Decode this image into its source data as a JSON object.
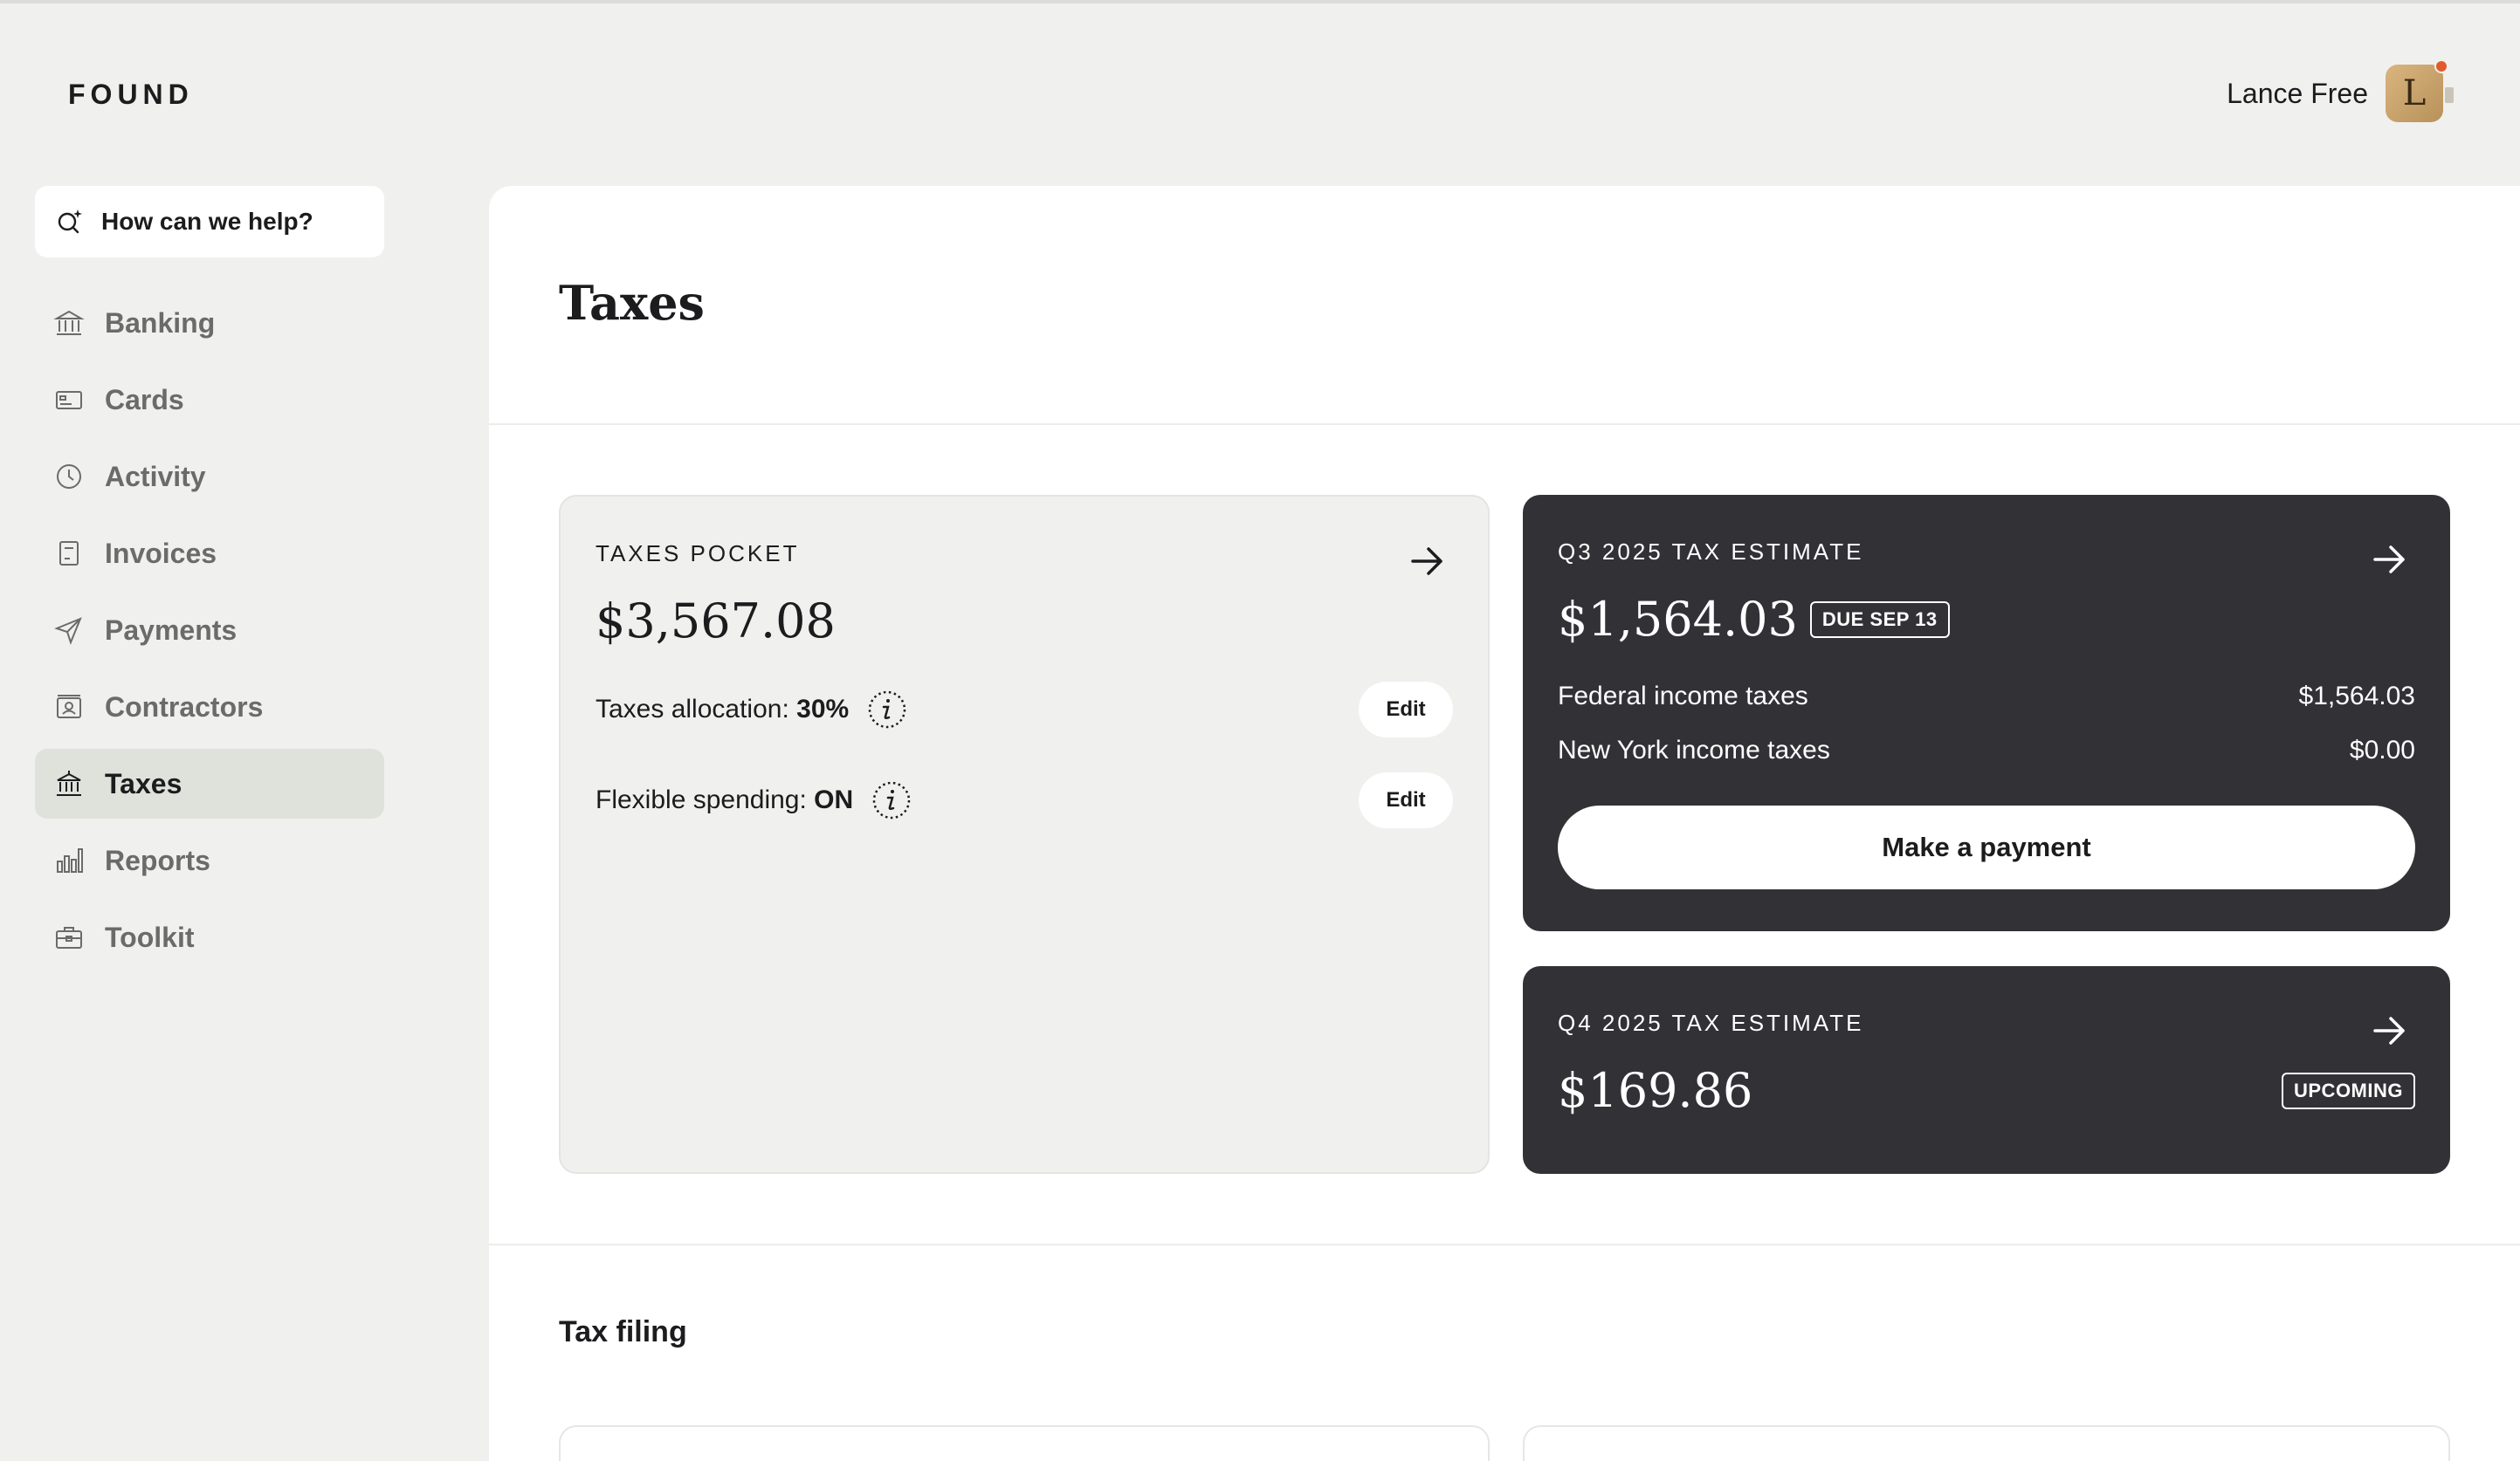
{
  "app": {
    "logo": "FOUND"
  },
  "user": {
    "name": "Lance Free",
    "avatar_initial": "L"
  },
  "search": {
    "label": "How can we help?",
    "icon": "search-sparkle-icon"
  },
  "sidebar": {
    "items": [
      {
        "label": "Banking",
        "icon": "bank-icon",
        "active": false
      },
      {
        "label": "Cards",
        "icon": "card-icon",
        "active": false
      },
      {
        "label": "Activity",
        "icon": "clock-icon",
        "active": false
      },
      {
        "label": "Invoices",
        "icon": "invoice-icon",
        "active": false
      },
      {
        "label": "Payments",
        "icon": "send-icon",
        "active": false
      },
      {
        "label": "Contractors",
        "icon": "contractor-icon",
        "active": false
      },
      {
        "label": "Taxes",
        "icon": "taxes-icon",
        "active": true
      },
      {
        "label": "Reports",
        "icon": "bar-chart-icon",
        "active": false
      },
      {
        "label": "Toolkit",
        "icon": "toolbox-icon",
        "active": false
      }
    ]
  },
  "main": {
    "title": "Taxes",
    "taxes_pocket": {
      "eyebrow": "TAXES POCKET",
      "amount": "$3,567.08",
      "allocation_label": "Taxes allocation:",
      "allocation_value": "30%",
      "flexible_label": "Flexible spending:",
      "flexible_value": "ON",
      "edit_label": "Edit"
    },
    "q3": {
      "eyebrow": "Q3 2025 TAX ESTIMATE",
      "amount": "$1,564.03",
      "badge": "DUE SEP 13",
      "lines": [
        {
          "label": "Federal income taxes",
          "value": "$1,564.03"
        },
        {
          "label": "New York income taxes",
          "value": "$0.00"
        }
      ],
      "pay_label": "Make a payment"
    },
    "q4": {
      "eyebrow": "Q4 2025 TAX ESTIMATE",
      "amount": "$169.86",
      "badge": "UPCOMING"
    },
    "tax_filing": {
      "title": "Tax filing"
    }
  },
  "colors": {
    "background": "#f0f0ee",
    "dark_card": "#313136",
    "active_nav": "#dfe2db",
    "notification_dot": "#e05a2b"
  }
}
